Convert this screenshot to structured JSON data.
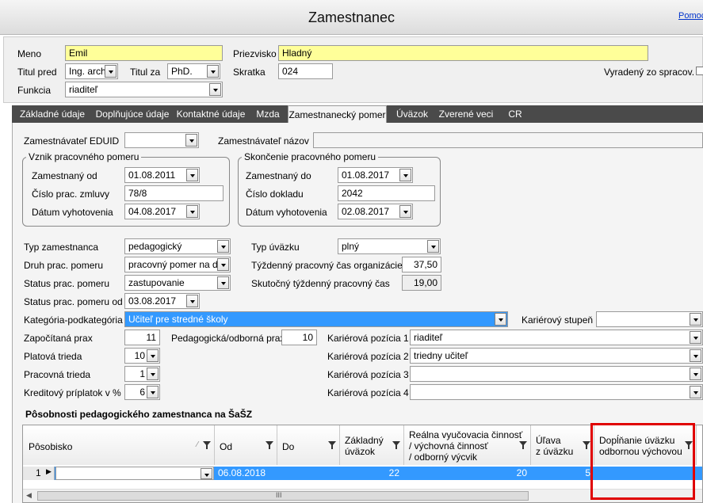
{
  "window": {
    "title": "Zamestnanec",
    "help_link": "Pomoc"
  },
  "header": {
    "meno_label": "Meno",
    "meno_value": "Emil",
    "priezvisko_label": "Priezvisko",
    "priezvisko_value": "Hladný",
    "titul_pred_label": "Titul pred",
    "titul_pred_value": "Ing. arch.",
    "titul_za_label": "Titul za",
    "titul_za_value": "PhD.",
    "skratka_label": "Skratka",
    "skratka_value": "024",
    "vyradeny_label": "Vyradený zo spracov.",
    "funkcia_label": "Funkcia",
    "funkcia_value": "riaditeľ"
  },
  "tabs": [
    "Základné údaje",
    "Doplňujúce údaje",
    "Kontaktné údaje",
    "Mzda",
    "Zamestnanecký pomer",
    "Úväzok",
    "Zverené veci",
    "CR"
  ],
  "active_tab": "Zamestnanecký pomer",
  "employer": {
    "eduid_label": "Zamestnávateľ EDUID",
    "eduid_value": "",
    "nazov_label": "Zamestnávateľ názov",
    "nazov_value": ""
  },
  "vznik": {
    "title": "Vznik pracovného pomeru",
    "od_label": "Zamestnaný od",
    "od_value": "01.08.2011",
    "zmluva_label": "Číslo prac. zmluvy",
    "zmluva_value": "78/8",
    "datum_label": "Dátum vyhotovenia",
    "datum_value": "04.08.2017"
  },
  "skoncenie": {
    "title": "Skončenie pracovného pomeru",
    "do_label": "Zamestnaný do",
    "do_value": "01.08.2017",
    "doklad_label": "Číslo dokladu",
    "doklad_value": "2042",
    "datum_label": "Dátum vyhotovenia",
    "datum_value": "02.08.2017"
  },
  "details": {
    "typ_zam_label": "Typ zamestnanca",
    "typ_zam_value": "pedagogický",
    "druh_label": "Druh prac. pomeru",
    "druh_value": "pracovný pomer na dob",
    "status_label": "Status prac. pomeru",
    "status_value": "zastupovanie",
    "status_od_label": "Status prac. pomeru od",
    "status_od_value": "03.08.2017",
    "typ_uvazku_label": "Typ úväzku",
    "typ_uvazku_value": "plný",
    "tyzdenny_label": "Týždenný pracovný čas organizácie",
    "tyzdenny_value": "37,50",
    "skutocny_label": "Skutočný týždenný pracovný čas",
    "skutocny_value": "19,00",
    "kategoria_label": "Kategória-podkategória",
    "kategoria_value": "Učiteľ pre stredné školy",
    "karierny_stupen_label": "Kariérový stupeň",
    "karierny_stupen_value": "",
    "zapocitana_label": "Započítaná prax",
    "zapocitana_value": "11",
    "pedagogicka_label": "Pedagogická/odborná prax",
    "pedagogicka_value": "10",
    "platova_label": "Platová trieda",
    "platova_value": "10",
    "pracovna_label": "Pracovná trieda",
    "pracovna_value": "1",
    "kreditovy_label": "Kreditový príplatok v %",
    "kreditovy_value": "6",
    "kp1_label": "Kariérová pozícia 1",
    "kp1_value": "riaditeľ",
    "kp2_label": "Kariérová pozícia 2",
    "kp2_value": "triedny učiteľ",
    "kp3_label": "Kariérová pozícia 3",
    "kp3_value": "",
    "kp4_label": "Kariérová pozícia 4",
    "kp4_value": ""
  },
  "grid": {
    "section_title": "Pôsobnosti pedagogického zamestnanca na ŠaŠZ",
    "columns": [
      "Pôsobisko",
      "Od",
      "Do",
      "Základný\núväzok",
      "Reálna vyučovacia činnosť\n/ výchovná činnosť\n/ odborný výcvik",
      "Úľava\nz úväzku",
      "Dopĺňanie úväzku\nodbornou výchovou"
    ],
    "row": {
      "num": "1",
      "posobisko": "",
      "od": "06.08.2018",
      "do": "",
      "zakladny": "22",
      "realna": "20",
      "ulava": "5",
      "doplnanie": ""
    },
    "scroll_glyph": "III"
  }
}
